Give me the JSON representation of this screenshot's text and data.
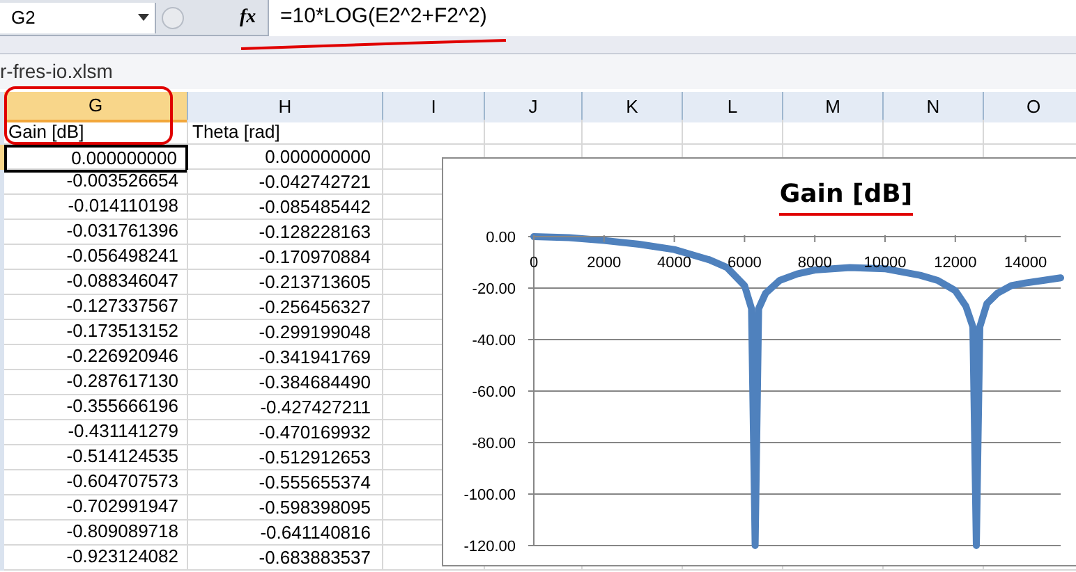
{
  "formula_bar": {
    "name_box": "G2",
    "function_label": "fx",
    "formula": "=10*LOG(E2^2+F2^2)"
  },
  "workbook_title": "r-fres-io.xlsm",
  "columns": [
    {
      "label": "G",
      "selected": true
    },
    {
      "label": "H",
      "selected": false
    },
    {
      "label": "I",
      "selected": false
    },
    {
      "label": "J",
      "selected": false
    },
    {
      "label": "K",
      "selected": false
    },
    {
      "label": "L",
      "selected": false
    },
    {
      "label": "M",
      "selected": false
    },
    {
      "label": "N",
      "selected": false
    },
    {
      "label": "O",
      "selected": false
    }
  ],
  "header_row": [
    "Gain [dB]",
    "Theta [rad]"
  ],
  "rows": [
    {
      "gain": "0.000000000",
      "theta": "0.000000000",
      "selected": true
    },
    {
      "gain": "-0.003526654",
      "theta": "-0.042742721",
      "selected": false
    },
    {
      "gain": "-0.014110198",
      "theta": "-0.085485442",
      "selected": false
    },
    {
      "gain": "-0.031761396",
      "theta": "-0.128228163",
      "selected": false
    },
    {
      "gain": "-0.056498241",
      "theta": "-0.170970884",
      "selected": false
    },
    {
      "gain": "-0.088346047",
      "theta": "-0.213713605",
      "selected": false
    },
    {
      "gain": "-0.127337567",
      "theta": "-0.256456327",
      "selected": false
    },
    {
      "gain": "-0.173513152",
      "theta": "-0.299199048",
      "selected": false
    },
    {
      "gain": "-0.226920946",
      "theta": "-0.341941769",
      "selected": false
    },
    {
      "gain": "-0.287617130",
      "theta": "-0.384684490",
      "selected": false
    },
    {
      "gain": "-0.355666196",
      "theta": "-0.427427211",
      "selected": false
    },
    {
      "gain": "-0.431141279",
      "theta": "-0.470169932",
      "selected": false
    },
    {
      "gain": "-0.514124535",
      "theta": "-0.512912653",
      "selected": false
    },
    {
      "gain": "-0.604707573",
      "theta": "-0.555655374",
      "selected": false
    },
    {
      "gain": "-0.702991947",
      "theta": "-0.598398095",
      "selected": false
    },
    {
      "gain": "-0.809089718",
      "theta": "-0.641140816",
      "selected": false
    },
    {
      "gain": "-0.923124082",
      "theta": "-0.683883537",
      "selected": false
    }
  ],
  "chart": {
    "chart_data": {
      "type": "line",
      "title": "Gain [dB]",
      "x": [
        0,
        1000,
        2000,
        3000,
        4000,
        4500,
        5000,
        5500,
        6000,
        6200,
        6300,
        6400,
        6600,
        7000,
        7500,
        8000,
        9000,
        10000,
        11000,
        11500,
        12000,
        12300,
        12500,
        12600,
        12700,
        12900,
        13200,
        13600,
        14000,
        14500,
        15000
      ],
      "series": [
        {
          "color": "#4f81bd",
          "values": [
            0,
            -0.4,
            -1.5,
            -3,
            -5,
            -7,
            -9,
            -12,
            -19,
            -28,
            -120,
            -28,
            -22,
            -17,
            -14.5,
            -13,
            -12,
            -12.5,
            -15,
            -17,
            -21,
            -27,
            -35,
            -120,
            -35,
            -26,
            -22,
            -19,
            -18,
            -17,
            -16
          ]
        }
      ],
      "xlim": [
        0,
        15000
      ],
      "ylim": [
        -120,
        0
      ],
      "grid": true,
      "xticks": [
        0,
        2000,
        4000,
        6000,
        8000,
        10000,
        12000,
        14000
      ],
      "yticks": [
        {
          "value": 0,
          "label": "0.00"
        },
        {
          "value": -20,
          "label": "-20.00"
        },
        {
          "value": -40,
          "label": "-40.00"
        },
        {
          "value": -60,
          "label": "-60.00"
        },
        {
          "value": -80,
          "label": "-80.00"
        },
        {
          "value": -100,
          "label": "-100.00"
        },
        {
          "value": -120,
          "label": "-120.00"
        }
      ]
    }
  }
}
